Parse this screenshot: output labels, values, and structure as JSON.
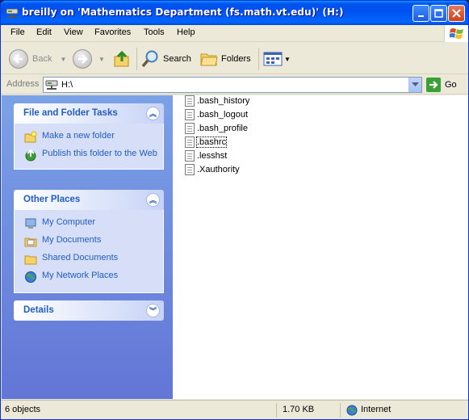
{
  "window": {
    "title": "breilly on 'Mathematics Department (fs.math.vt.edu)' (H:)"
  },
  "menu": {
    "items": [
      "File",
      "Edit",
      "View",
      "Favorites",
      "Tools",
      "Help"
    ]
  },
  "toolbar": {
    "back_label": "Back",
    "search_label": "Search",
    "folders_label": "Folders"
  },
  "address": {
    "label": "Address",
    "value": "H:\\",
    "go_label": "Go"
  },
  "taskpane": {
    "file_tasks": {
      "title": "File and Folder Tasks",
      "items": [
        "Make a new folder",
        "Publish this folder to the Web"
      ]
    },
    "other_places": {
      "title": "Other Places",
      "items": [
        "My Computer",
        "My Documents",
        "Shared Documents",
        "My Network Places"
      ]
    },
    "details": {
      "title": "Details"
    }
  },
  "files": [
    {
      "name": ".bash_history"
    },
    {
      "name": ".bash_logout"
    },
    {
      "name": ".bash_profile"
    },
    {
      "name": ".bashrc"
    },
    {
      "name": ".lesshst"
    },
    {
      "name": ".Xauthority"
    }
  ],
  "status": {
    "objects": "6 objects",
    "size": "1.70 KB",
    "zone": "Internet"
  },
  "colors": {
    "title_blue": "#0053ee",
    "task_link": "#215dc6",
    "pane_gradient_top": "#7ba2e7",
    "pane_gradient_bottom": "#6375d6"
  }
}
